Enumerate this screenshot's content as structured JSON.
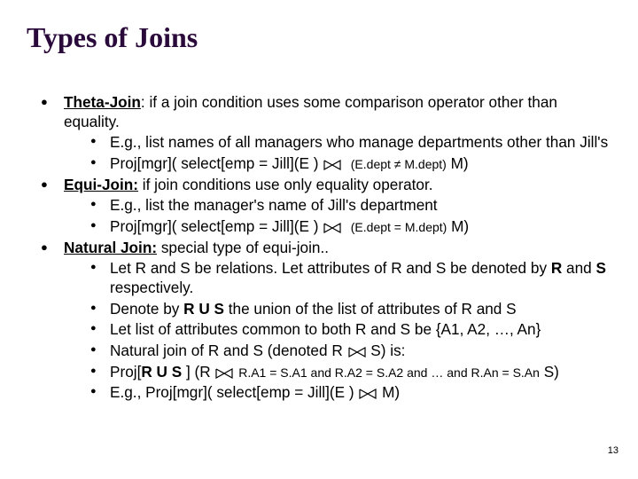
{
  "title": "Types of Joins",
  "pagenum": "13",
  "bullets": [
    {
      "head_html": "<span class='term'>Theta-Join</span>: if a join condition uses some comparison operator other than equality.",
      "subs": [
        "E.g., list names of all managers who manage departments other than Jill's",
        "Proj[mgr]( select[emp = Jill](E ) <svg class='joinsym' width='20' height='12'><polyline points='1,1 19,11 19,1 1,11 1,1' fill='none' stroke='#000' stroke-width='1.2'/></svg>&nbsp;&nbsp;<span class='sub'>(E.dept ≠ M.dept)</span> M)"
      ]
    },
    {
      "head_html": "<span class='term'>Equi-Join:</span> if join conditions use only equality operator.",
      "subs": [
        "E.g., list the manager's name of Jill's department",
        "Proj[mgr]( select[emp = Jill](E ) <svg class='joinsym' width='20' height='12'><polyline points='1,1 19,11 19,1 1,11 1,1' fill='none' stroke='#000' stroke-width='1.2'/></svg>&nbsp;&nbsp;<span class='sub'>(E.dept = M.dept)</span> M)"
      ]
    },
    {
      "head_html": "<span class='term'>Natural Join:</span> special type of equi-join..",
      "subs": [
        "Let R and S be relations. Let attributes of R and S be denoted by <span class='b'>R</span> and <span class='b'>S</span> respectively.",
        "Denote by <span class='b'>R U S</span> the union of the list of attributes of R and S",
        "Let list of attributes common to both R and S be {A1, A2, …, An}",
        "Natural join of R and S (denoted R <svg class='joinsym' width='20' height='12'><polyline points='1,1 19,11 19,1 1,11 1,1' fill='none' stroke='#000' stroke-width='1.2'/></svg> S) is:",
        "Proj[<span class='b'>R U S</span> ] (R <svg class='joinsym' width='20' height='12'><polyline points='1,1 19,11 19,1 1,11 1,1' fill='none' stroke='#000' stroke-width='1.2'/></svg> <span class='sub'>R.A1 = S.A1 and R.A2 = S.A2 and … and R.An = S.An</span> S)",
        "E.g., Proj[mgr]( select[emp = Jill](E ) <svg class='joinsym' width='20' height='12'><polyline points='1,1 19,11 19,1 1,11 1,1' fill='none' stroke='#000' stroke-width='1.2'/></svg> M)"
      ]
    }
  ]
}
